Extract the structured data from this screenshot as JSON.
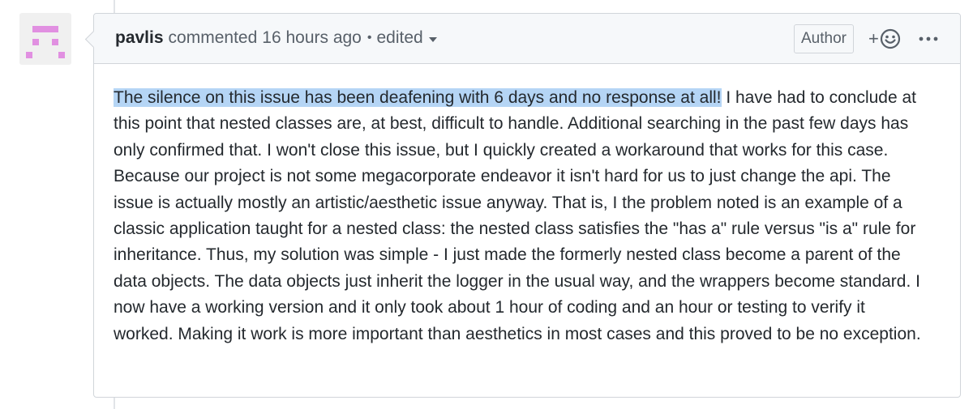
{
  "comment": {
    "author": "pavlis",
    "action": "commented",
    "time": "16 hours ago",
    "separator": "•",
    "edited_label": "edited",
    "author_badge": "Author",
    "reaction_plus": "+",
    "body_highlighted": "The silence on this issue has been deafening with 6 days and no response at all!",
    "body_rest": " I have had to conclude at this point that nested classes are, at best, difficult to handle. Additional searching in the past few days has only confirmed that. I won't close this issue, but I quickly created a workaround that works for this case. Because our project is not some megacorporate endeavor it isn't hard for us to just change the api. The issue is actually mostly an artistic/aesthetic issue anyway. That is, I the problem noted is an example of a classic application taught for a nested class: the nested class satisfies the \"has a\" rule versus \"is a\" rule for inheritance. Thus, my solution was simple - I just made the formerly nested class become a parent of the data objects. The data objects just inherit the logger in the usual way, and the wrappers become standard. I now have a working version and it only took about 1 hour of coding and an hour or testing to verify it worked. Making it work is more important than aesthetics in most cases and this proved to be no exception."
  },
  "colors": {
    "highlight": "#b5d5f5",
    "avatar_pink": "#e190e1",
    "header_bg": "#f6f8fa",
    "border": "#d1d5da",
    "muted_text": "#586069"
  },
  "icons": {
    "avatar": "identicon",
    "reaction": "smiley-icon",
    "more": "kebab-horizontal-icon",
    "dropdown": "triangle-down-icon"
  }
}
